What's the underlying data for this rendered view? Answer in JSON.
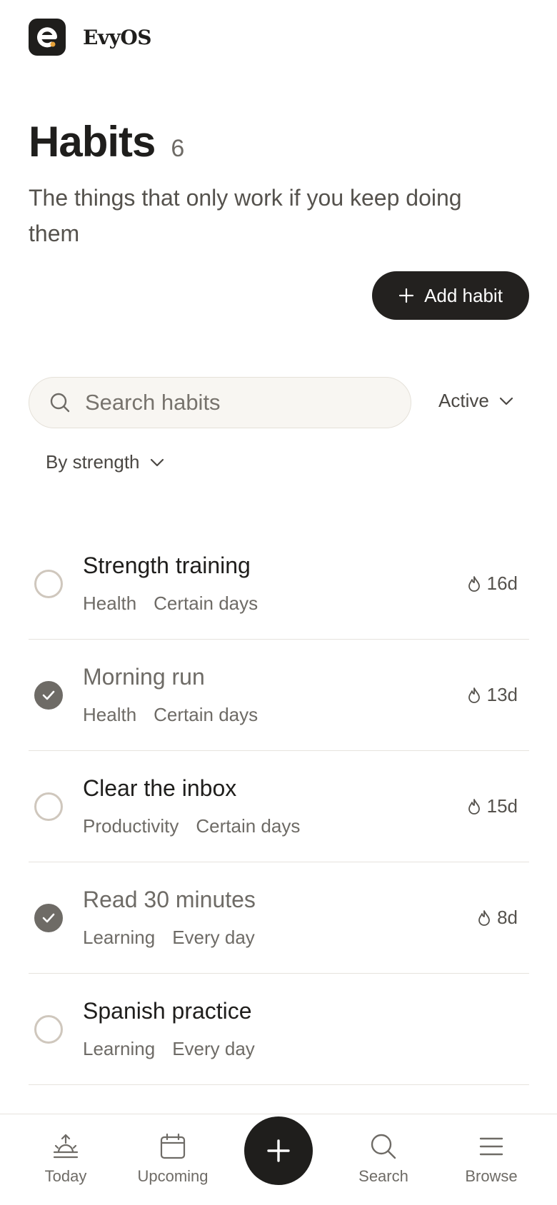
{
  "app": {
    "brand": "EvyOS"
  },
  "page": {
    "title": "Habits",
    "count": "6",
    "subtitle": "The things that only work if you keep doing them"
  },
  "actions": {
    "add_label": "Add habit"
  },
  "search": {
    "placeholder": "Search habits"
  },
  "filters": {
    "status": "Active",
    "sort": "By strength"
  },
  "habits": [
    {
      "name": "Strength training",
      "category": "Health",
      "schedule": "Certain days",
      "streak": "16d",
      "done": false
    },
    {
      "name": "Morning run",
      "category": "Health",
      "schedule": "Certain days",
      "streak": "13d",
      "done": true
    },
    {
      "name": "Clear the inbox",
      "category": "Productivity",
      "schedule": "Certain days",
      "streak": "15d",
      "done": false
    },
    {
      "name": "Read 30 minutes",
      "category": "Learning",
      "schedule": "Every day",
      "streak": "8d",
      "done": true
    },
    {
      "name": "Spanish practice",
      "category": "Learning",
      "schedule": "Every day",
      "streak": "",
      "done": false
    }
  ],
  "tabs": [
    {
      "label": "Today",
      "icon": "sunrise-icon"
    },
    {
      "label": "Upcoming",
      "icon": "calendar-icon"
    },
    {
      "label": "Search",
      "icon": "search-icon"
    },
    {
      "label": "Browse",
      "icon": "menu-icon"
    }
  ],
  "colors": {
    "accent": "#e8a33a",
    "primary": "#1f1e1c",
    "muted": "#6e6b66"
  }
}
